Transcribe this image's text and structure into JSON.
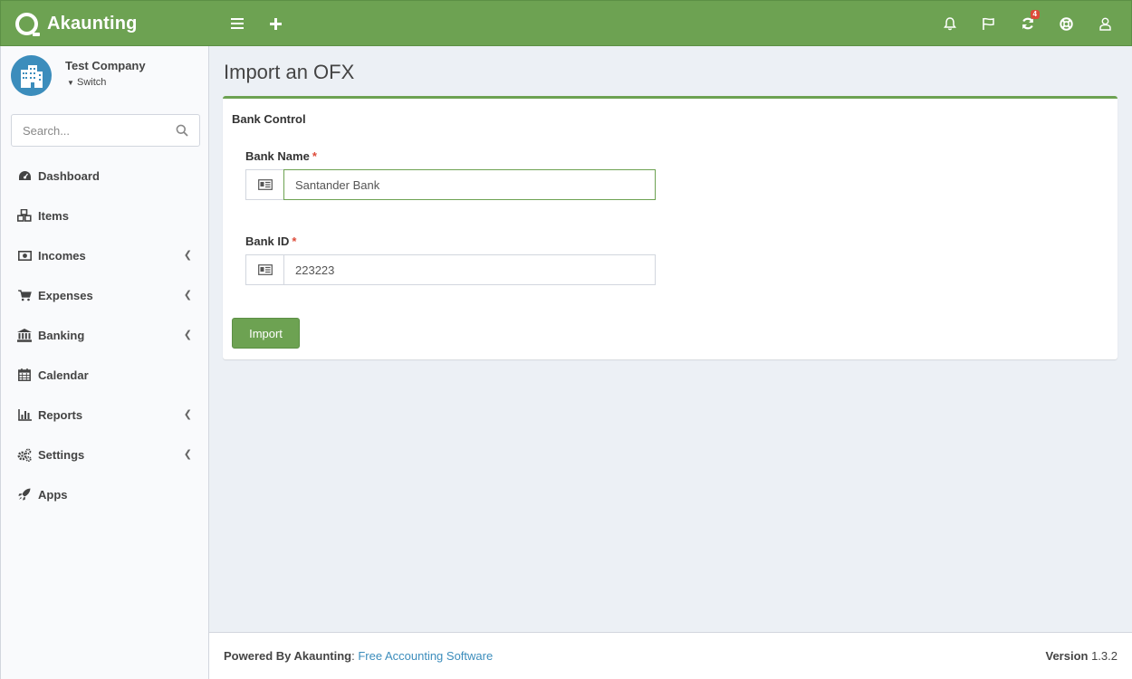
{
  "header": {
    "brand": "Akaunting",
    "notifications_badge": "4",
    "accent_color": "#6da252"
  },
  "sidebar": {
    "company_name": "Test Company",
    "switch_label": "Switch",
    "search_placeholder": "Search...",
    "items": [
      {
        "label": "Dashboard",
        "icon": "dashboard-icon",
        "has_children": false
      },
      {
        "label": "Items",
        "icon": "cubes-icon",
        "has_children": false
      },
      {
        "label": "Incomes",
        "icon": "money-icon",
        "has_children": true
      },
      {
        "label": "Expenses",
        "icon": "shopping-cart-icon",
        "has_children": true
      },
      {
        "label": "Banking",
        "icon": "university-icon",
        "has_children": true
      },
      {
        "label": "Calendar",
        "icon": "calendar-icon",
        "has_children": false
      },
      {
        "label": "Reports",
        "icon": "bar-chart-icon",
        "has_children": true
      },
      {
        "label": "Settings",
        "icon": "gears-icon",
        "has_children": true
      },
      {
        "label": "Apps",
        "icon": "rocket-icon",
        "has_children": false
      }
    ]
  },
  "main": {
    "title": "Import an OFX",
    "box_title": "Bank Control",
    "bank_name": {
      "label": "Bank Name",
      "required": "*",
      "value": "Santander Bank"
    },
    "bank_id": {
      "label": "Bank ID",
      "required": "*",
      "value": "223223"
    },
    "import_button": "Import"
  },
  "footer": {
    "powered_by": "Powered By Akaunting",
    "separator": ": ",
    "link_text": "Free Accounting Software",
    "version_label": "Version",
    "version": "1.3.2"
  }
}
